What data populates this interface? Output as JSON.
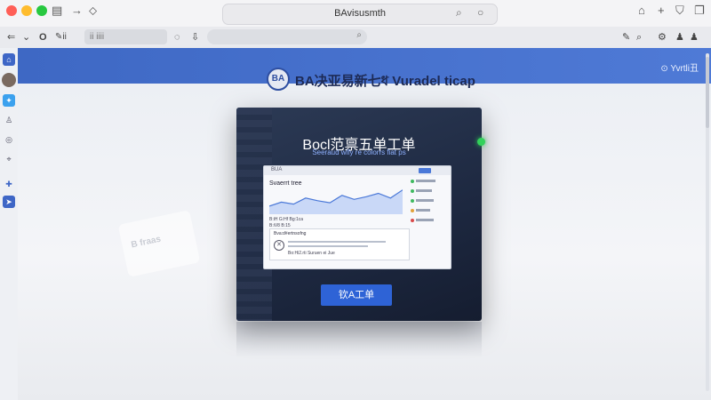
{
  "titlebar": {
    "address": "BAvisusmth"
  },
  "toolbar": {
    "tab_label": "ii  iiii",
    "search_placeholder": ""
  },
  "sidebar": {
    "icons": [
      "home-icon",
      "avatar",
      "twitter-icon",
      "user-icon",
      "globe-icon",
      "location-icon",
      "puzzle-icon",
      "send-icon"
    ]
  },
  "banner": {
    "link_label": "Yvrtli丑"
  },
  "brand": {
    "logo": "BA",
    "name": "BA决亚易新七ধ Vuradel ticap"
  },
  "ghost_card": {
    "text": "B fraas"
  },
  "hero": {
    "title": "Bocl范禀五单工单",
    "subtitle": "Seeraud wlfy re colorrs fiat ps"
  },
  "dashboard": {
    "header": "BUA",
    "title": "Svaerrt tree",
    "row1": "B:iH  G:Hf    Bg:1ca",
    "row2": "B:iV8   B:15",
    "panel_title": "Bva:d#ertnsofng",
    "panel_note": "Bo:Hi2.rti   Suruen ei Jue",
    "chart": {
      "type": "area",
      "values": [
        12,
        18,
        15,
        24,
        20,
        17,
        28,
        22,
        26,
        31,
        24,
        36
      ]
    }
  },
  "cta": {
    "label": "钦A工单"
  },
  "colors": {
    "banner": "#4f7ad6",
    "cta": "#2e63d6",
    "hero_bg": "#1d2840",
    "status": "#32d15a"
  }
}
